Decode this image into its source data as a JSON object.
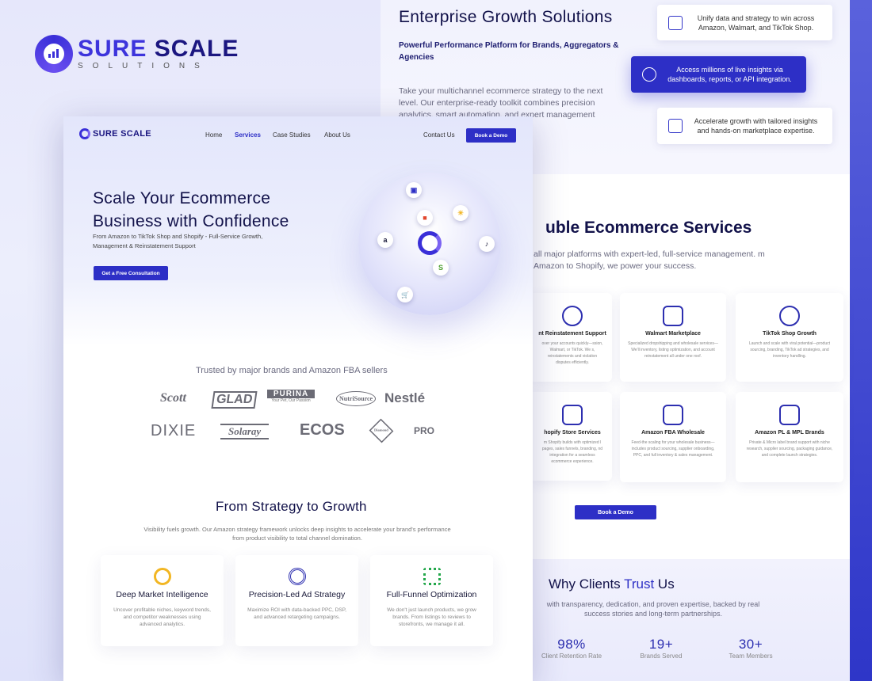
{
  "brand": {
    "name_a": "SURE",
    "name_b": " SCALE",
    "tagline": "SOLUTIONS"
  },
  "back": {
    "title": "Enterprise Growth Solutions",
    "subtitle": "Powerful Performance Platform for Brands, Aggregators & Agencies",
    "paragraph": "Take your multichannel ecommerce strategy to the next level. Our enterprise-ready toolkit combines precision analytics, smart automation, and expert management across Amazon,",
    "features": [
      {
        "text": "Unify data and strategy to win across Amazon, Walmart, and TikTok Shop.",
        "icon": "cube-icon"
      },
      {
        "text": "Access millions of live insights via dashboards, reports, or API integration.",
        "icon": "touch-icon"
      },
      {
        "text": "Accelerate growth with tailored insights and hands-on marketplace expertise.",
        "icon": "growth-chart-icon"
      }
    ],
    "services_title": "uble Ecommerce Services",
    "services_sub": "all major platforms with expert-led, full-service management. m Amazon to Shopify, we power your success.",
    "services": [
      {
        "title": "nt Reinstatement Support",
        "desc": "over your accounts quickly—ssion, Walmart, or TikTok. We s, reinstatements and violation disputes efficiently.",
        "icon": "user-support-icon"
      },
      {
        "title": "Walmart Marketplace",
        "desc": "Specialized dropshipping and wholesale services—We'll inventory, listing optimization, and account reinstatement all under one roof.",
        "icon": "store-icon"
      },
      {
        "title": "TikTok Shop Growth",
        "desc": "Launch and scale with viral potential—product sourcing, branding, TikTok ad strategies, and inventory handling.",
        "icon": "tiktok-icon"
      },
      {
        "title": "hopify Store Services",
        "desc": "m Shopify builds with optimized l pages, sales funnels, branding, nd integration for a seamless ecommerce experience.",
        "icon": "shopify-bag-icon"
      },
      {
        "title": "Amazon FBA Wholesale",
        "desc": "Feed-the scaling for your wholesale business—includes product sourcing, supplier onboarding, PPC, and full inventory & sales management.",
        "icon": "price-tag-icon"
      },
      {
        "title": "Amazon PL & MPL Brands",
        "desc": "Private & Micro label brand support with niche research, supplier sourcing, packaging guidance, and complete launch strategies.",
        "icon": "lock-laptop-icon"
      }
    ],
    "services_button": "Book a Demo",
    "trust_title_a": "Why Clients ",
    "trust_title_b": "Trust",
    "trust_title_c": " Us",
    "trust_sub": "with transparency, dedication, and proven expertise, backed by real success stories and long-term partnerships.",
    "stats": [
      {
        "value": "98%",
        "label": "Client Retention Rate"
      },
      {
        "value": "19+",
        "label": "Brands Served"
      },
      {
        "value": "30+",
        "label": "Team Members"
      }
    ]
  },
  "front": {
    "logo": "SURE SCALE",
    "nav": [
      "Home",
      "Services",
      "Case Studies",
      "About Us"
    ],
    "contact": "Contact Us",
    "demo": "Book a Demo",
    "hero_title": "Scale Your Ecommerce Business with Confidence",
    "hero_sub": "From Amazon to TikTok Shop  and Shopify - Full-Service Growth, Management & Reinstatement Support",
    "hero_button": "Get a Free Consultation",
    "chips": [
      "a",
      "♪",
      "☀",
      "S",
      "🛒",
      "▣",
      "■"
    ],
    "trusted_by": "Trusted by major brands and Amazon FBA sellers",
    "brands_row1": [
      "Scott",
      "GLAD",
      "PURINA",
      "NutriSource",
      "Nestlé"
    ],
    "brands_row2": [
      "DIXIE",
      "Solaray",
      "ECOS",
      "Diamond",
      "PRO"
    ],
    "purina_tag": "Your Pet, Our Passion",
    "strategy_title": "From Strategy to Growth",
    "strategy_sub": "Visibility fuels growth. Our Amazon strategy framework unlocks deep insights to accelerate your brand's performance from product visibility to total channel domination.",
    "cards": [
      {
        "title": "Deep Market Intelligence",
        "desc": "Uncover profitable niches, keyword trends, and competitor weaknesses using advanced analytics.",
        "icon": "magnifier-icon",
        "color": "#f2b623"
      },
      {
        "title": "Precision-Led Ad Strategy",
        "desc": "Maximize ROI with data-backed PPC, DSP, and advanced retargeting campaigns.",
        "icon": "crosshair-icon",
        "color": "#2d2fb0"
      },
      {
        "title": "Full-Funnel Optimization",
        "desc": "We don't just launch products, we grow brands. From listings to reviews to storefronts, we manage it all.",
        "icon": "network-icon",
        "color": "#22a74a"
      }
    ]
  },
  "colors": {
    "accent": "#2d2fc6",
    "navy": "#12124a"
  }
}
